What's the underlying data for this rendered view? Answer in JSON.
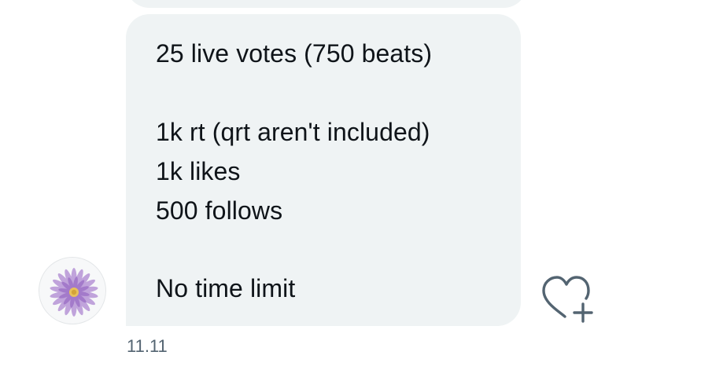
{
  "message": {
    "lines": [
      "25 live votes (750 beats)",
      "1k rt (qrt aren't included)",
      "1k likes",
      "500 follows",
      "No time limit"
    ]
  },
  "timestamp": "11.11",
  "avatar": {
    "icon": "flower-icon",
    "color": "#a57cc8"
  },
  "reaction": {
    "icon": "heart-plus-icon",
    "color": "#536471"
  },
  "colors": {
    "bubble": "#eff3f4",
    "text": "#0f1419",
    "secondary_text": "#536471"
  }
}
